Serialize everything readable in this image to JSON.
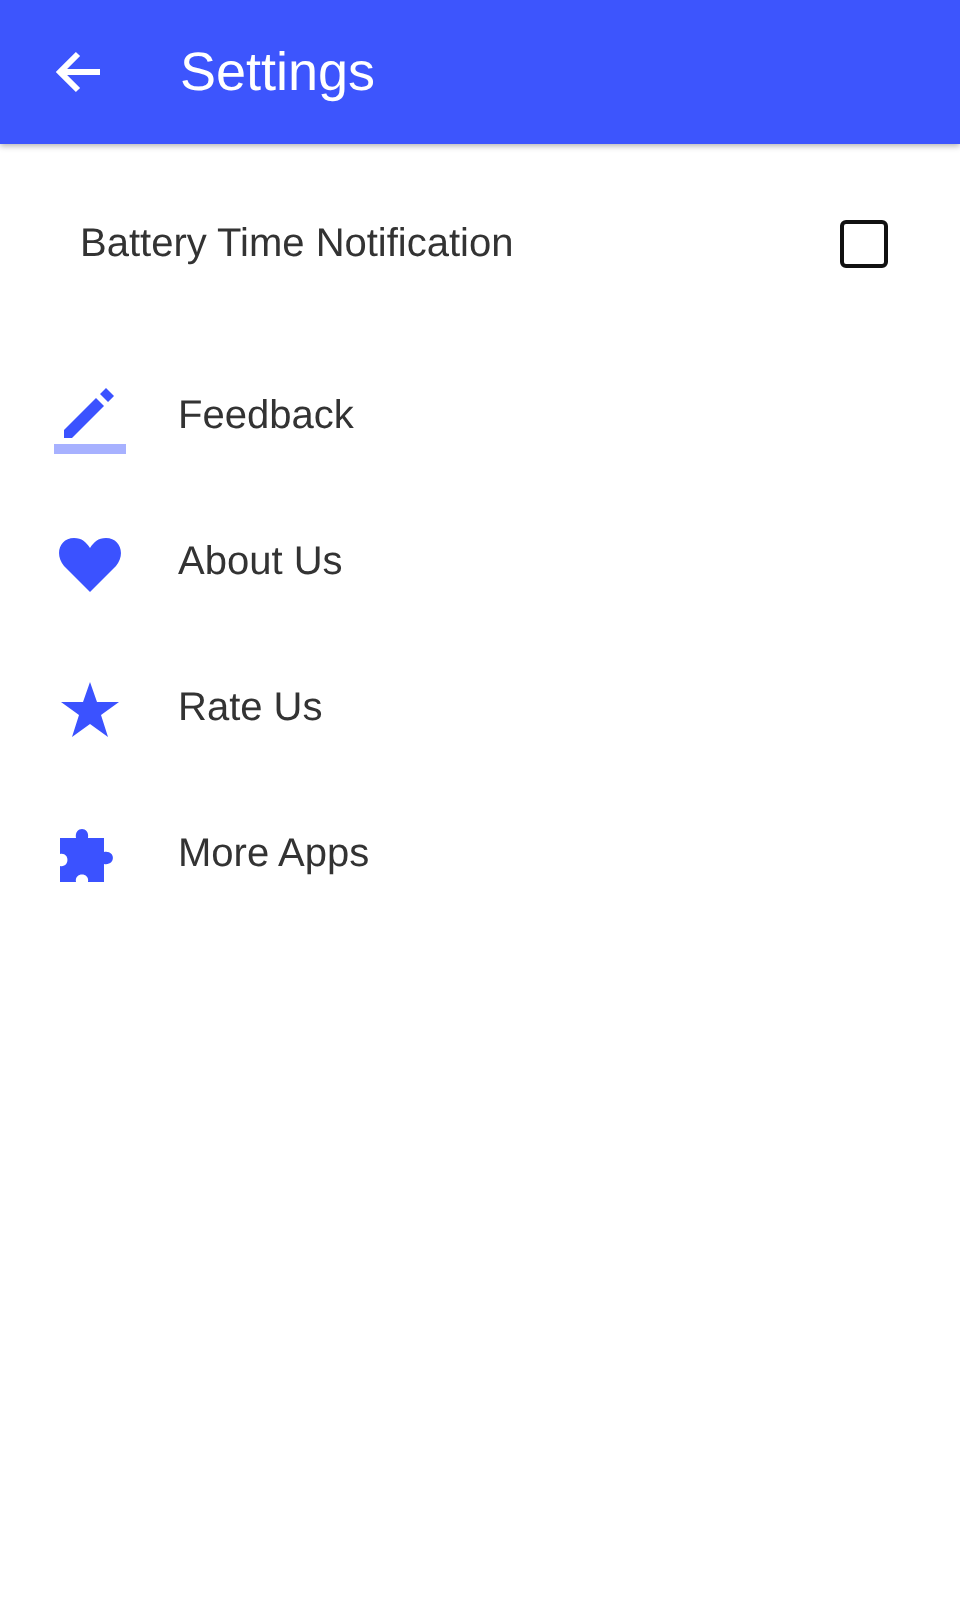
{
  "app_bar": {
    "title": "Settings"
  },
  "notification": {
    "label": "Battery Time Notification",
    "checked": false
  },
  "items": [
    {
      "label": "Feedback",
      "kind": "pencil"
    },
    {
      "label": "About Us",
      "kind": "heart"
    },
    {
      "label": "Rate Us",
      "kind": "star"
    },
    {
      "label": "More Apps",
      "kind": "puzzle"
    }
  ]
}
